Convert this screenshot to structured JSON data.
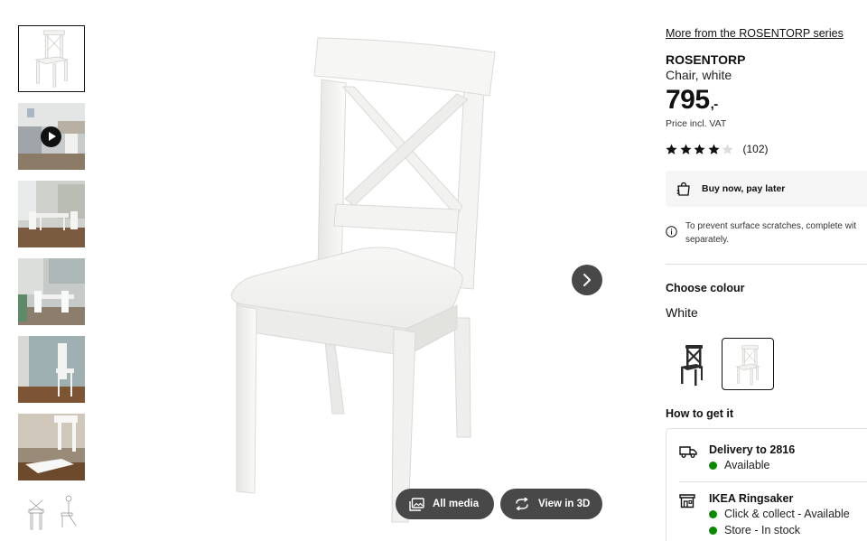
{
  "gallery": {
    "thumbnails": [
      {
        "kind": "product-white",
        "active": true
      },
      {
        "kind": "video",
        "active": false
      },
      {
        "kind": "room-dining",
        "active": false
      },
      {
        "kind": "room-dining-2",
        "active": false
      },
      {
        "kind": "room-wall",
        "active": false
      },
      {
        "kind": "closeup",
        "active": false
      },
      {
        "kind": "line-drawing",
        "active": false
      }
    ],
    "all_media_label": "All media",
    "view_3d_label": "View in 3D"
  },
  "product": {
    "series_link": "More from the ROSENTORP series",
    "name": "ROSENTORP",
    "description": "Chair, white",
    "price": "795",
    "price_suffix": ",-",
    "vat_note": "Price incl. VAT",
    "rating": {
      "stars": 4,
      "max": 5,
      "count": "(102)"
    },
    "buy_now_label": "Buy now, pay later",
    "notice_line1": "To prevent surface scratches, complete wit",
    "notice_line2": "separately."
  },
  "colour": {
    "heading": "Choose colour",
    "selected": "White",
    "swatches": [
      {
        "name": "black",
        "color": "#2b2b2b",
        "selected": false
      },
      {
        "name": "white",
        "color": "#ffffff",
        "selected": true
      }
    ]
  },
  "fulfilment": {
    "heading": "How to get it",
    "delivery_title": "Delivery to 2816",
    "delivery_status": "Available",
    "store_title": "IKEA Ringsaker",
    "store_status_1": "Click & collect - Available",
    "store_status_2": "Store - In stock",
    "status_color": "#0a8a00"
  }
}
